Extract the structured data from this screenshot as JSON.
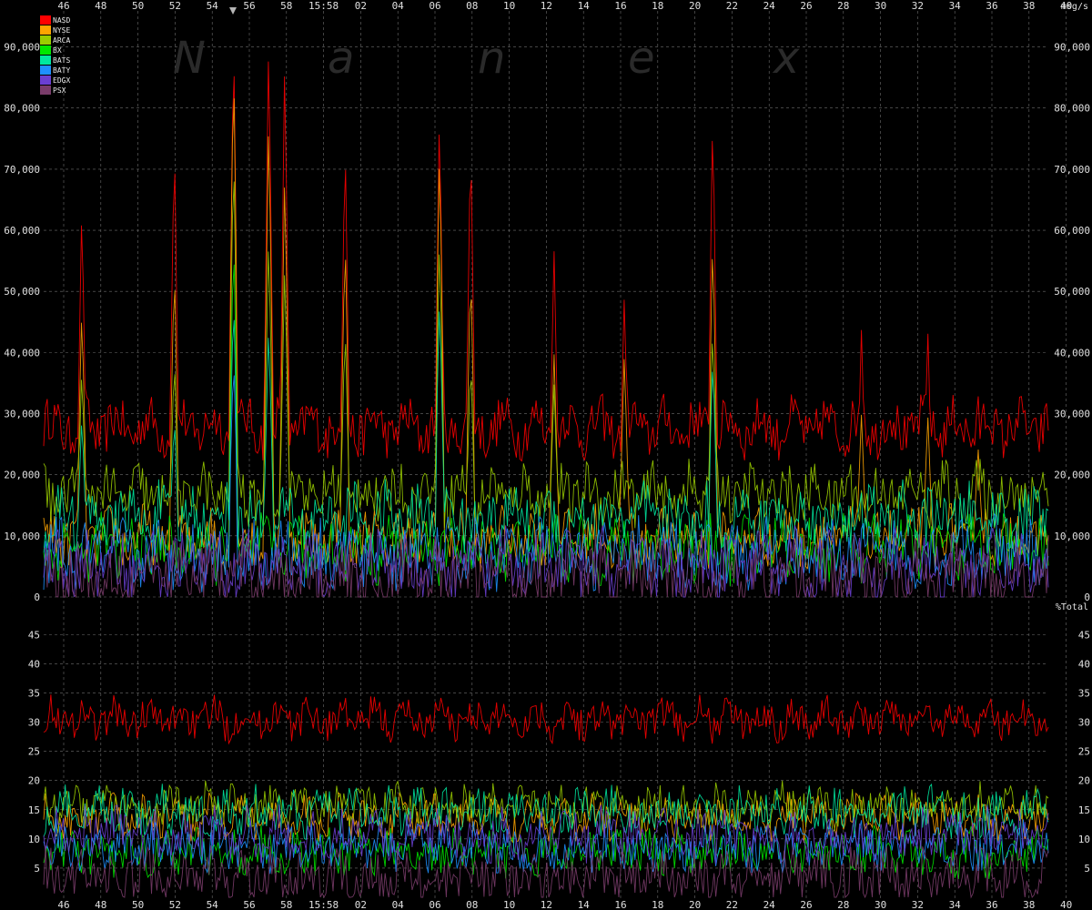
{
  "watermark": [
    "N",
    "a",
    "n",
    "e",
    "x"
  ],
  "chart_data": {
    "type": "line",
    "x_tick_labels": [
      "46",
      "48",
      "50",
      "52",
      "54",
      "56",
      "58",
      "15:58",
      "02",
      "04",
      "06",
      "08",
      "10",
      "12",
      "14",
      "16",
      "18",
      "20",
      "22",
      "24",
      "26",
      "28",
      "30",
      "32",
      "34",
      "36",
      "38",
      "40"
    ],
    "grid": true,
    "legend": {
      "placement": "top-left",
      "entries": [
        {
          "name": "NASD",
          "color": "#ff0000"
        },
        {
          "name": "NYSE",
          "color": "#ffa500"
        },
        {
          "name": "ARCA",
          "color": "#9acd00"
        },
        {
          "name": "BX",
          "color": "#00e800"
        },
        {
          "name": "BATS",
          "color": "#00e8a0"
        },
        {
          "name": "BATY",
          "color": "#1e90ff"
        },
        {
          "name": "EDGX",
          "color": "#6a3fd1"
        },
        {
          "name": "PSX",
          "color": "#7a3c6a"
        }
      ]
    },
    "panels": [
      {
        "id": "message_rate",
        "unit_label": "msg/s",
        "ylim": [
          0,
          95000
        ],
        "y_ticks": [
          0,
          10000,
          20000,
          30000,
          40000,
          50000,
          60000,
          70000,
          80000,
          90000
        ],
        "y_tick_labels": [
          "0",
          "10,000",
          "20,000",
          "30,000",
          "40,000",
          "50,000",
          "60,000",
          "70,000",
          "80,000",
          "90,000"
        ],
        "series_baseline": {
          "NASD": 27000,
          "NYSE": 9000,
          "ARCA": 16000,
          "BX": 7000,
          "BATS": 12000,
          "BATY": 6000,
          "EDGX": 4000,
          "PSX": 2500
        },
        "spikes": [
          {
            "x": 0.038,
            "values": {
              "NASD": 65000,
              "NYSE": 48000,
              "ARCA": 38000,
              "BATS": 30000
            }
          },
          {
            "x": 0.13,
            "values": {
              "NASD": 76000,
              "NYSE": 55000,
              "ARCA": 40000,
              "BATS": 30000
            }
          },
          {
            "x": 0.189,
            "values": {
              "NASD": 94000,
              "NYSE": 90000,
              "ARCA": 75000,
              "BX": 60000,
              "BATS": 50000,
              "BATY": 40000
            }
          },
          {
            "x": 0.224,
            "values": {
              "NASD": 93000,
              "NYSE": 80000,
              "ARCA": 60000,
              "BATS": 45000
            }
          },
          {
            "x": 0.24,
            "values": {
              "NASD": 89000,
              "NYSE": 70000,
              "ARCA": 55000
            }
          },
          {
            "x": 0.3,
            "values": {
              "NASD": 76000,
              "NYSE": 60000,
              "ARCA": 45000
            }
          },
          {
            "x": 0.394,
            "values": {
              "NASD": 81000,
              "NYSE": 75000,
              "ARCA": 60000,
              "BATS": 50000
            }
          },
          {
            "x": 0.425,
            "values": {
              "NASD": 77000,
              "NYSE": 55000,
              "ARCA": 40000
            }
          },
          {
            "x": 0.508,
            "values": {
              "NASD": 57000,
              "NYSE": 40000,
              "ARCA": 35000
            }
          },
          {
            "x": 0.578,
            "values": {
              "NASD": 50000,
              "NYSE": 40000
            }
          },
          {
            "x": 0.666,
            "values": {
              "NASD": 81000,
              "NYSE": 60000,
              "ARCA": 45000,
              "BATS": 40000
            }
          },
          {
            "x": 0.814,
            "values": {
              "NASD": 44000,
              "NYSE": 30000
            }
          },
          {
            "x": 0.88,
            "values": {
              "NASD": 44000,
              "NYSE": 30000
            }
          },
          {
            "x": 0.93,
            "values": {
              "NASD": 34000,
              "NYSE": 25000
            }
          }
        ]
      },
      {
        "id": "percent_of_total",
        "unit_label": "%Total",
        "ylim": [
          0,
          48
        ],
        "y_ticks": [
          5,
          10,
          15,
          20,
          25,
          30,
          35,
          40,
          45
        ],
        "y_tick_labels": [
          "5",
          "10",
          "15",
          "20",
          "25",
          "30",
          "35",
          "40",
          "45"
        ],
        "series_baseline": {
          "NASD": 30,
          "NYSE": 13,
          "ARCA": 15,
          "BX": 7,
          "BATS": 14,
          "BATY": 8,
          "EDGX": 10,
          "PSX": 3
        }
      }
    ]
  }
}
